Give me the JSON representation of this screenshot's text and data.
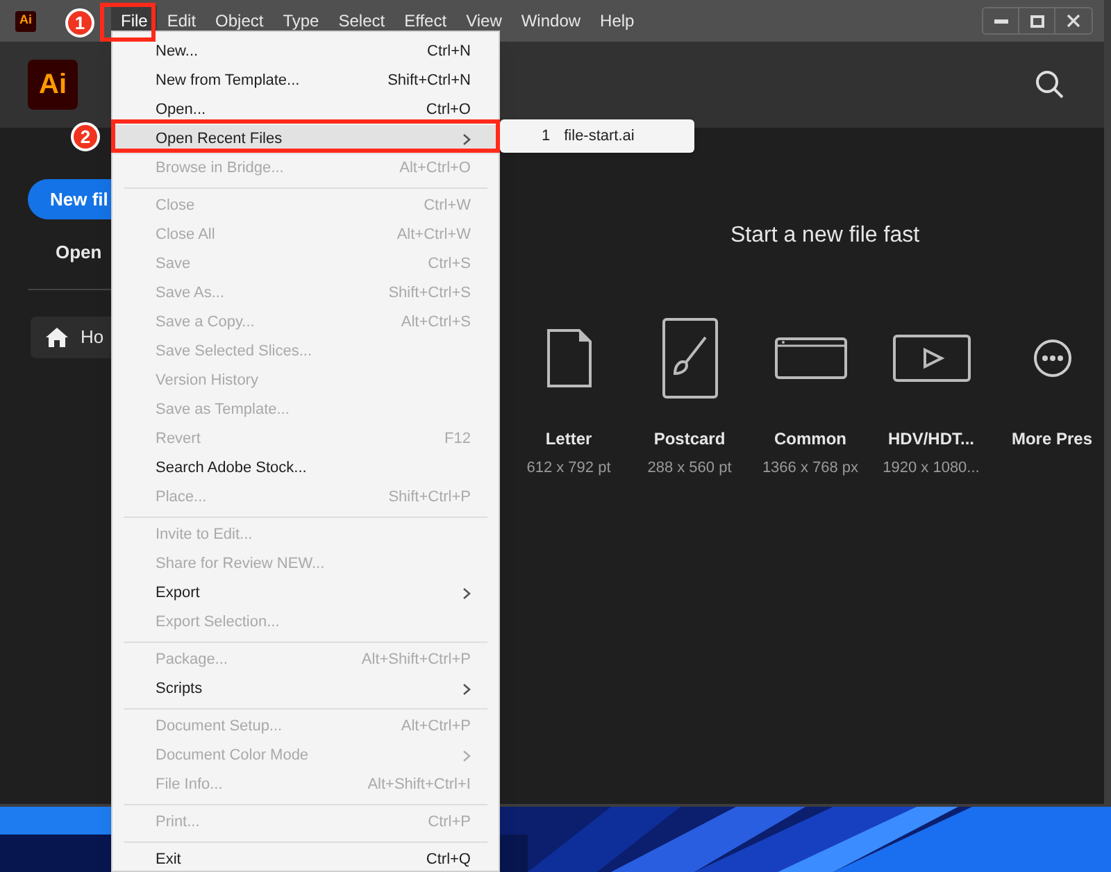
{
  "title_bar": {
    "app_icon": "Ai",
    "menus": [
      {
        "label": "File",
        "selected": true
      },
      {
        "label": "Edit",
        "selected": false
      },
      {
        "label": "Object",
        "selected": false
      },
      {
        "label": "Type",
        "selected": false
      },
      {
        "label": "Select",
        "selected": false
      },
      {
        "label": "Effect",
        "selected": false
      },
      {
        "label": "View",
        "selected": false
      },
      {
        "label": "Window",
        "selected": false
      },
      {
        "label": "Help",
        "selected": false
      }
    ]
  },
  "header": {
    "logo": "Ai"
  },
  "sidebar": {
    "new_file_button": "New fil",
    "open_link": "Open",
    "nav": [
      {
        "label": "Ho",
        "selected": true
      }
    ]
  },
  "main": {
    "heading": "Start a new file fast",
    "presets": [
      {
        "kind": "letter",
        "name": "Letter",
        "size": "612 x 792 pt"
      },
      {
        "kind": "postcard",
        "name": "Postcard",
        "size": "288 x 560 pt"
      },
      {
        "kind": "common",
        "name": "Common",
        "size": "1366 x 768 px"
      },
      {
        "kind": "video",
        "name": "HDV/HDT...",
        "size": "1920 x 1080..."
      },
      {
        "kind": "more",
        "name": "More Pres"
      }
    ]
  },
  "file_menu": {
    "items": [
      {
        "kind": "item",
        "label": "New...",
        "shortcut": "Ctrl+N",
        "disabled": false,
        "submenu": false,
        "selected": false
      },
      {
        "kind": "item",
        "label": "New from Template...",
        "shortcut": "Shift+Ctrl+N",
        "disabled": false,
        "submenu": false,
        "selected": false
      },
      {
        "kind": "item",
        "label": "Open...",
        "shortcut": "Ctrl+O",
        "disabled": false,
        "submenu": false,
        "selected": false
      },
      {
        "kind": "item",
        "label": "Open Recent Files",
        "disabled": false,
        "submenu": true,
        "selected": true
      },
      {
        "kind": "item",
        "label": "Browse in Bridge...",
        "shortcut": "Alt+Ctrl+O",
        "disabled": true,
        "submenu": false,
        "selected": false
      },
      {
        "kind": "separator"
      },
      {
        "kind": "item",
        "label": "Close",
        "shortcut": "Ctrl+W",
        "disabled": true,
        "submenu": false,
        "selected": false
      },
      {
        "kind": "item",
        "label": "Close All",
        "shortcut": "Alt+Ctrl+W",
        "disabled": true,
        "submenu": false,
        "selected": false
      },
      {
        "kind": "item",
        "label": "Save",
        "shortcut": "Ctrl+S",
        "disabled": true,
        "submenu": false,
        "selected": false
      },
      {
        "kind": "item",
        "label": "Save As...",
        "shortcut": "Shift+Ctrl+S",
        "disabled": true,
        "submenu": false,
        "selected": false
      },
      {
        "kind": "item",
        "label": "Save a Copy...",
        "shortcut": "Alt+Ctrl+S",
        "disabled": true,
        "submenu": false,
        "selected": false
      },
      {
        "kind": "item",
        "label": "Save Selected Slices...",
        "disabled": true,
        "submenu": false,
        "selected": false
      },
      {
        "kind": "item",
        "label": "Version History",
        "disabled": true,
        "submenu": false,
        "selected": false
      },
      {
        "kind": "item",
        "label": "Save as Template...",
        "disabled": true,
        "submenu": false,
        "selected": false
      },
      {
        "kind": "item",
        "label": "Revert",
        "shortcut": "F12",
        "disabled": true,
        "submenu": false,
        "selected": false
      },
      {
        "kind": "item",
        "label": "Search Adobe Stock...",
        "disabled": false,
        "submenu": false,
        "selected": false
      },
      {
        "kind": "item",
        "label": "Place...",
        "shortcut": "Shift+Ctrl+P",
        "disabled": true,
        "submenu": false,
        "selected": false
      },
      {
        "kind": "separator"
      },
      {
        "kind": "item",
        "label": "Invite to Edit...",
        "disabled": true,
        "submenu": false,
        "selected": false
      },
      {
        "kind": "item",
        "label": "Share for Review NEW...",
        "disabled": true,
        "submenu": false,
        "selected": false
      },
      {
        "kind": "item",
        "label": "Export",
        "disabled": false,
        "submenu": true,
        "selected": false
      },
      {
        "kind": "item",
        "label": "Export Selection...",
        "disabled": true,
        "submenu": false,
        "selected": false
      },
      {
        "kind": "separator"
      },
      {
        "kind": "item",
        "label": "Package...",
        "shortcut": "Alt+Shift+Ctrl+P",
        "disabled": true,
        "submenu": false,
        "selected": false
      },
      {
        "kind": "item",
        "label": "Scripts",
        "disabled": false,
        "submenu": true,
        "selected": false
      },
      {
        "kind": "separator"
      },
      {
        "kind": "item",
        "label": "Document Setup...",
        "shortcut": "Alt+Ctrl+P",
        "disabled": true,
        "submenu": false,
        "selected": false
      },
      {
        "kind": "item",
        "label": "Document Color Mode",
        "disabled": true,
        "submenu": true,
        "selected": false
      },
      {
        "kind": "item",
        "label": "File Info...",
        "shortcut": "Alt+Shift+Ctrl+I",
        "disabled": true,
        "submenu": false,
        "selected": false
      },
      {
        "kind": "separator"
      },
      {
        "kind": "item",
        "label": "Print...",
        "shortcut": "Ctrl+P",
        "disabled": true,
        "submenu": false,
        "selected": false
      },
      {
        "kind": "separator"
      },
      {
        "kind": "item",
        "label": "Exit",
        "shortcut": "Ctrl+Q",
        "disabled": false,
        "submenu": false,
        "selected": false
      }
    ]
  },
  "recent_submenu": [
    {
      "number": "1",
      "label": "file-start.ai"
    }
  ],
  "annotations": [
    {
      "number": "1"
    },
    {
      "number": "2"
    }
  ]
}
